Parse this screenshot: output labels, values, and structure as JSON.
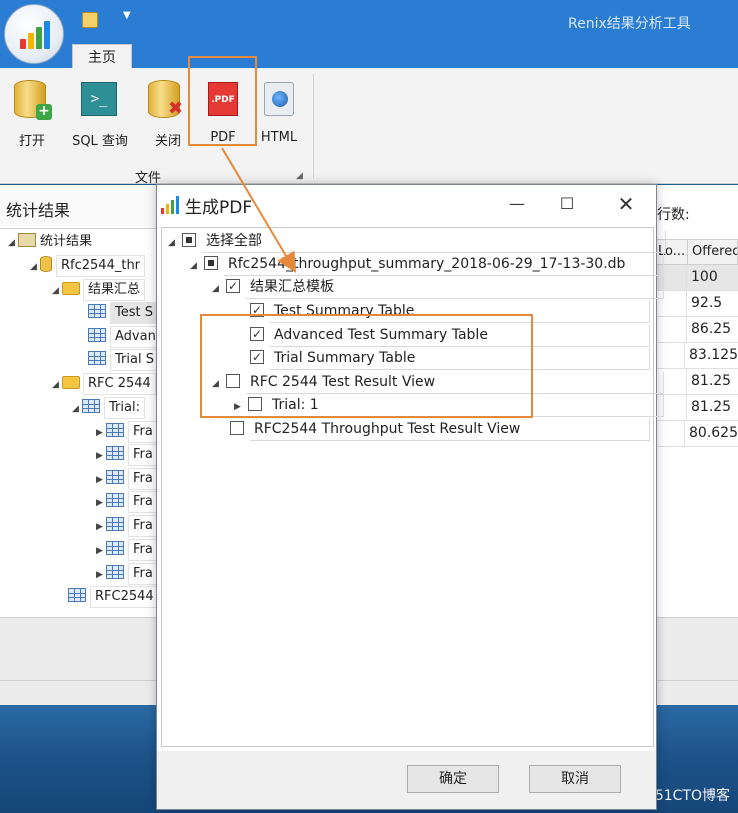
{
  "app": {
    "title": "Renix结果分析工具",
    "tab_home": "主页",
    "group_file": "文件"
  },
  "ribbon": {
    "open": "打开",
    "sql_query": "SQL 查询",
    "close": "关闭",
    "pdf": "PDF",
    "pdf_icon_text": ".PDF",
    "html": "HTML"
  },
  "left_panel": {
    "header": "统计结果",
    "nodes": {
      "root": "统计结果",
      "db": "Rfc2544_thr",
      "template_folder": "结果汇总",
      "test_summary": "Test S",
      "advanced": "Advan",
      "trial_summary": "Trial S",
      "rfc_folder": "RFC 2544",
      "trial": "Trial: ",
      "fr": "Fra",
      "rfc_view": "RFC2544"
    }
  },
  "right_panel": {
    "rows_label": "行数:",
    "col1": "Lo...",
    "col2": "Offered",
    "values": [
      "100",
      "92.5",
      "86.25",
      "83.125",
      "81.25",
      "81.25",
      "80.625"
    ]
  },
  "dialog": {
    "title": "生成PDF",
    "select_all": "选择全部",
    "db_file": "Rfc2544_throughput_summary_2018-06-29_17-13-30.db",
    "template": "结果汇总模板",
    "items": [
      "Test Summary Table",
      "Advanced Test Summary Table",
      "Trial Summary Table"
    ],
    "result_view": "RFC 2544 Test Result View",
    "trial": "Trial: 1",
    "throughput_view": "RFC2544 Throughput Test Result View",
    "ok": "确定",
    "cancel": "取消"
  },
  "watermark": "@51CTO博客",
  "colors": {
    "ribbon_blue": "#2b7cd3",
    "highlight_orange": "#e58a3a",
    "pdf_red": "#e53935"
  },
  "icons": [
    "app-orb-icon",
    "quick-access-icon",
    "open-db-icon",
    "sql-icon",
    "close-db-icon",
    "pdf-icon",
    "html-icon",
    "folder-icon",
    "database-icon",
    "table-icon",
    "chart-icon"
  ]
}
